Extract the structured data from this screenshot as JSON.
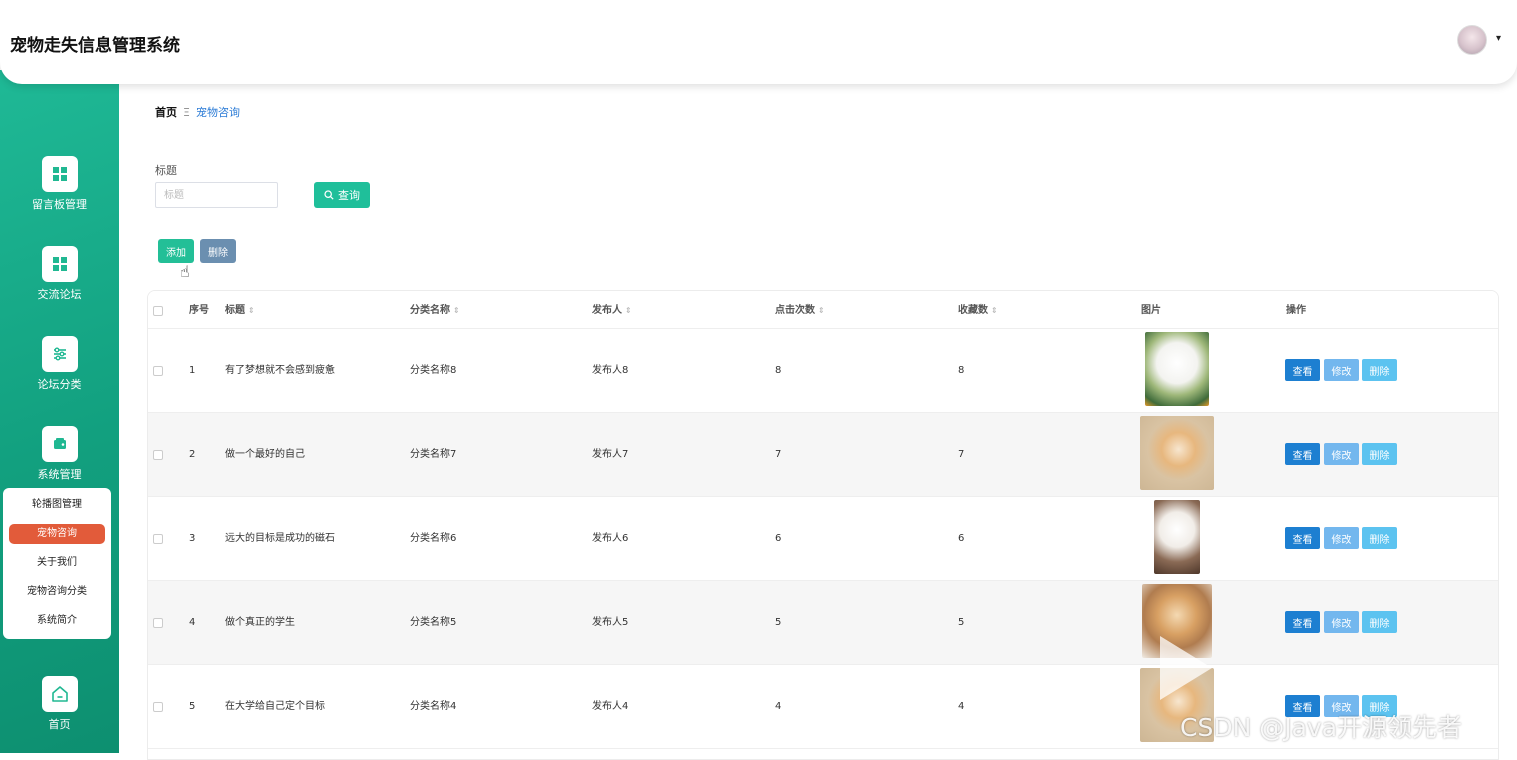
{
  "header": {
    "title": "宠物走失信息管理系统",
    "avatar_caret": "▾"
  },
  "sidebar": {
    "items": [
      {
        "label": "留言板管理",
        "icon": "grid-icon"
      },
      {
        "label": "交流论坛",
        "icon": "grid-icon"
      },
      {
        "label": "论坛分类",
        "icon": "sliders-icon"
      },
      {
        "label": "系统管理",
        "icon": "wallet-icon"
      },
      {
        "label": "首页",
        "icon": "home-icon"
      }
    ],
    "submenu": [
      {
        "label": "轮播图管理",
        "active": false
      },
      {
        "label": "宠物咨询",
        "active": true
      },
      {
        "label": "关于我们",
        "active": false
      },
      {
        "label": "宠物咨询分类",
        "active": false
      },
      {
        "label": "系统简介",
        "active": false
      }
    ]
  },
  "breadcrumb": {
    "home": "首页",
    "separator": "Ξ",
    "current": "宠物咨询"
  },
  "filter": {
    "label": "标题",
    "placeholder": "标题",
    "value": "",
    "search_label": "查询"
  },
  "actions": {
    "add_label": "添加",
    "delete_label": "删除"
  },
  "table": {
    "columns": [
      "序号",
      "标题",
      "分类名称",
      "发布人",
      "点击次数",
      "收藏数",
      "图片",
      "操作"
    ],
    "op_labels": {
      "view": "查看",
      "edit": "修改",
      "delete": "删除"
    },
    "rows": [
      {
        "index": "1",
        "title": "有了梦想就不会感到疲惫",
        "category": "分类名称8",
        "publisher": "发布人8",
        "clicks": "8",
        "favorites": "8",
        "image": "white-fluffy-puppy-image"
      },
      {
        "index": "2",
        "title": "做一个最好的自己",
        "category": "分类名称7",
        "publisher": "发布人7",
        "clicks": "7",
        "favorites": "7",
        "image": "corgi-puppy-image"
      },
      {
        "index": "3",
        "title": "远大的目标是成功的磁石",
        "category": "分类名称6",
        "publisher": "发布人6",
        "clicks": "6",
        "favorites": "6",
        "image": "white-puppy-image"
      },
      {
        "index": "4",
        "title": "做个真正的学生",
        "category": "分类名称5",
        "publisher": "发布人5",
        "clicks": "5",
        "favorites": "5",
        "image": "pomeranian-puppy-image"
      },
      {
        "index": "5",
        "title": "在大学给自己定个目标",
        "category": "分类名称4",
        "publisher": "发布人4",
        "clicks": "4",
        "favorites": "4",
        "image": "corgi-puppy-image"
      }
    ]
  },
  "watermark": "CSDN @Java开源领先者"
}
